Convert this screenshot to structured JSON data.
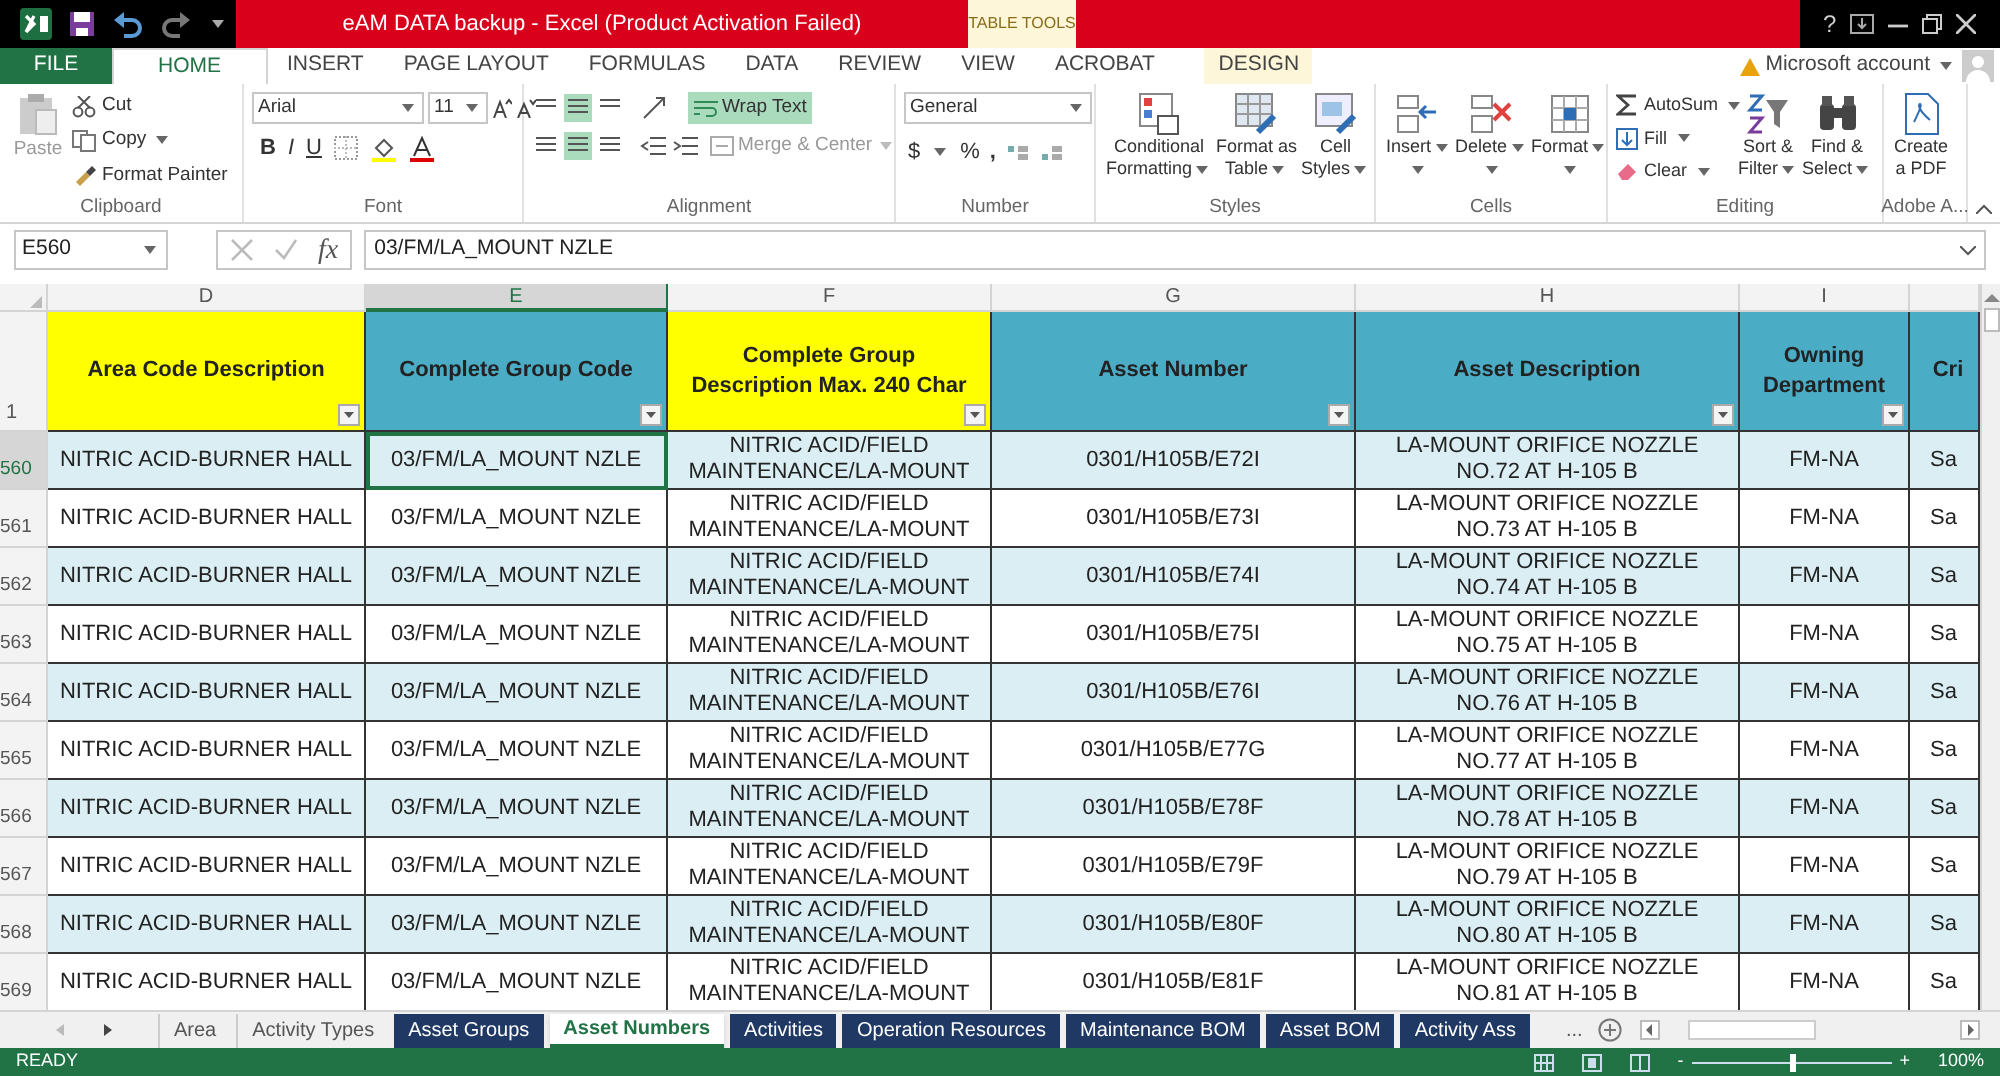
{
  "title_bar": {
    "title": "eAM DATA backup -  Excel (Product Activation Failed)",
    "context_tab": "TABLE TOOLS",
    "help": "?"
  },
  "ribbon_tabs": [
    {
      "label": "FILE",
      "kind": "file",
      "selected": false
    },
    {
      "label": "HOME",
      "kind": "normal",
      "selected": true
    },
    {
      "label": "INSERT",
      "kind": "normal",
      "selected": false
    },
    {
      "label": "PAGE LAYOUT",
      "kind": "normal",
      "selected": false
    },
    {
      "label": "FORMULAS",
      "kind": "normal",
      "selected": false
    },
    {
      "label": "DATA",
      "kind": "normal",
      "selected": false
    },
    {
      "label": "REVIEW",
      "kind": "normal",
      "selected": false
    },
    {
      "label": "VIEW",
      "kind": "normal",
      "selected": false
    },
    {
      "label": "ACROBAT",
      "kind": "normal",
      "selected": false
    },
    {
      "label": "DESIGN",
      "kind": "context",
      "selected": false
    }
  ],
  "account": "Microsoft account",
  "clipboard": {
    "paste": "Paste",
    "cut": "Cut",
    "copy": "Copy",
    "format_painter": "Format Painter",
    "label": "Clipboard"
  },
  "font": {
    "name": "Arial",
    "size": "11",
    "bold": "B",
    "italic": "I",
    "underline": "U",
    "label": "Font"
  },
  "alignment": {
    "wrap_text": {
      "label": "Wrap Text",
      "selected": true
    },
    "merge": "Merge & Center",
    "label": "Alignment"
  },
  "number": {
    "format": "General",
    "currency": "$",
    "percent": "%",
    "comma": ",",
    "label": "Number"
  },
  "styles": {
    "buttons": [
      [
        "Conditional",
        "Formatting"
      ],
      [
        "Format as",
        "Table"
      ],
      [
        "Cell",
        "Styles"
      ]
    ],
    "label": "Styles"
  },
  "cells": {
    "buttons": [
      "Insert",
      "Delete",
      "Format"
    ],
    "label": "Cells"
  },
  "editing": {
    "autosum": "AutoSum",
    "fill": "Fill",
    "clear": "Clear",
    "buttons": [
      [
        "Sort &",
        "Filter"
      ],
      [
        "Find &",
        "Select"
      ]
    ],
    "label": "Editing"
  },
  "adobe": {
    "button": [
      "Create",
      "a PDF"
    ],
    "label": "Adobe A..."
  },
  "formula_bar": {
    "name_box": "E560",
    "fx": "fx",
    "formula": "03/FM/LA_MOUNT NZLE"
  },
  "columns": [
    {
      "letter": "D",
      "header": "Area Code Description",
      "color": "#ffff00",
      "selected": false
    },
    {
      "letter": "E",
      "header": "Complete Group Code",
      "color": "#4bacc6",
      "selected": true
    },
    {
      "letter": "F",
      "header": "Complete Group Description Max. 240 Char",
      "color": "#ffff00",
      "selected": false
    },
    {
      "letter": "G",
      "header": "Asset Number",
      "color": "#4bacc6",
      "selected": false
    },
    {
      "letter": "H",
      "header": "Asset Description",
      "color": "#4bacc6",
      "selected": false
    },
    {
      "letter": "I",
      "header": "Owning Department",
      "color": "#4bacc6",
      "selected": false
    },
    {
      "header": "Cri",
      "color": "#4bacc6",
      "selected": false
    }
  ],
  "header_row_number": "1",
  "rows": [
    {
      "number": "560",
      "selected": true,
      "cells": [
        "NITRIC ACID-BURNER HALL",
        "03/FM/LA_MOUNT NZLE",
        "NITRIC ACID/FIELD MAINTENANCE/LA-MOUNT",
        "0301/H105B/E72I",
        "LA-MOUNT ORIFICE NOZZLE NO.72 AT H-105 B",
        "FM-NA",
        "Sa"
      ]
    },
    {
      "number": "561",
      "selected": false,
      "cells": [
        "NITRIC ACID-BURNER HALL",
        "03/FM/LA_MOUNT NZLE",
        "NITRIC ACID/FIELD MAINTENANCE/LA-MOUNT",
        "0301/H105B/E73I",
        "LA-MOUNT ORIFICE NOZZLE NO.73 AT H-105 B",
        "FM-NA",
        "Sa"
      ]
    },
    {
      "number": "562",
      "selected": false,
      "cells": [
        "NITRIC ACID-BURNER HALL",
        "03/FM/LA_MOUNT NZLE",
        "NITRIC ACID/FIELD MAINTENANCE/LA-MOUNT",
        "0301/H105B/E74I",
        "LA-MOUNT ORIFICE NOZZLE NO.74 AT H-105 B",
        "FM-NA",
        "Sa"
      ]
    },
    {
      "number": "563",
      "selected": false,
      "cells": [
        "NITRIC ACID-BURNER HALL",
        "03/FM/LA_MOUNT NZLE",
        "NITRIC ACID/FIELD MAINTENANCE/LA-MOUNT",
        "0301/H105B/E75I",
        "LA-MOUNT ORIFICE NOZZLE NO.75 AT H-105 B",
        "FM-NA",
        "Sa"
      ]
    },
    {
      "number": "564",
      "selected": false,
      "cells": [
        "NITRIC ACID-BURNER HALL",
        "03/FM/LA_MOUNT NZLE",
        "NITRIC ACID/FIELD MAINTENANCE/LA-MOUNT",
        "0301/H105B/E76I",
        "LA-MOUNT ORIFICE NOZZLE NO.76 AT H-105 B",
        "FM-NA",
        "Sa"
      ]
    },
    {
      "number": "565",
      "selected": false,
      "cells": [
        "NITRIC ACID-BURNER HALL",
        "03/FM/LA_MOUNT NZLE",
        "NITRIC ACID/FIELD MAINTENANCE/LA-MOUNT",
        "0301/H105B/E77G",
        "LA-MOUNT ORIFICE NOZZLE NO.77 AT H-105 B",
        "FM-NA",
        "Sa"
      ]
    },
    {
      "number": "566",
      "selected": false,
      "cells": [
        "NITRIC ACID-BURNER HALL",
        "03/FM/LA_MOUNT NZLE",
        "NITRIC ACID/FIELD MAINTENANCE/LA-MOUNT",
        "0301/H105B/E78F",
        "LA-MOUNT ORIFICE NOZZLE NO.78 AT H-105 B",
        "FM-NA",
        "Sa"
      ]
    },
    {
      "number": "567",
      "selected": false,
      "cells": [
        "NITRIC ACID-BURNER HALL",
        "03/FM/LA_MOUNT NZLE",
        "NITRIC ACID/FIELD MAINTENANCE/LA-MOUNT",
        "0301/H105B/E79F",
        "LA-MOUNT ORIFICE NOZZLE NO.79 AT H-105 B",
        "FM-NA",
        "Sa"
      ]
    },
    {
      "number": "568",
      "selected": false,
      "cells": [
        "NITRIC ACID-BURNER HALL",
        "03/FM/LA_MOUNT NZLE",
        "NITRIC ACID/FIELD MAINTENANCE/LA-MOUNT",
        "0301/H105B/E80F",
        "LA-MOUNT ORIFICE NOZZLE NO.80 AT H-105 B",
        "FM-NA",
        "Sa"
      ]
    },
    {
      "number": "569",
      "selected": false,
      "cells": [
        "NITRIC ACID-BURNER HALL",
        "03/FM/LA_MOUNT NZLE",
        "NITRIC ACID/FIELD MAINTENANCE/LA-MOUNT",
        "0301/H105B/E81F",
        "LA-MOUNT ORIFICE NOZZLE NO.81 AT H-105 B",
        "FM-NA",
        "Sa"
      ]
    }
  ],
  "sheet_tabs": [
    {
      "label": "Area",
      "kind": "plain",
      "selected": false
    },
    {
      "label": "Activity Types",
      "kind": "plain",
      "selected": false
    },
    {
      "label": "Asset Groups",
      "kind": "colored",
      "selected": false
    },
    {
      "label": "Asset Numbers",
      "kind": "colored",
      "selected": true
    },
    {
      "label": "Activities",
      "kind": "colored",
      "selected": false
    },
    {
      "label": "Operation Resources",
      "kind": "colored",
      "selected": false
    },
    {
      "label": "Maintenance BOM",
      "kind": "colored",
      "selected": false
    },
    {
      "label": "Asset BOM",
      "kind": "colored",
      "selected": false
    },
    {
      "label": "Activity Ass",
      "kind": "colored",
      "selected": false
    }
  ],
  "more_tabs": "...",
  "status_bar": {
    "status": "READY",
    "zoom": {
      "minus": "-",
      "plus": "+",
      "level": 0.5,
      "reading": "100%"
    }
  }
}
